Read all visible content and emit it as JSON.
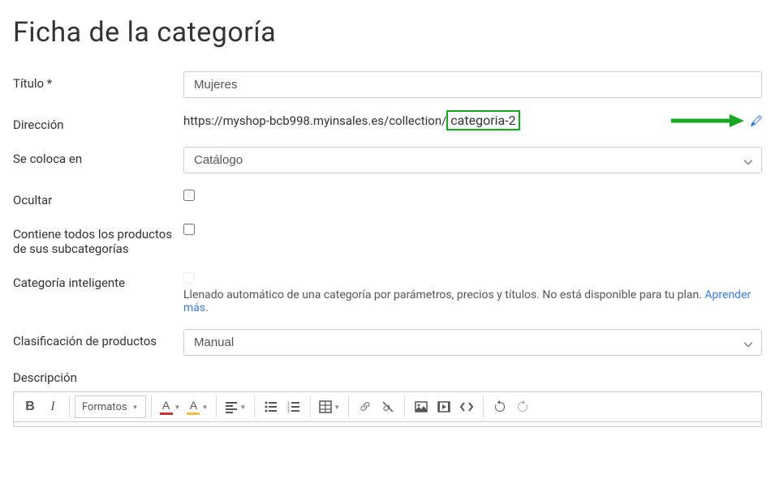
{
  "page": {
    "title": "Ficha de la categoría"
  },
  "form": {
    "title_label": "Título *",
    "title_value": "Mujeres",
    "address_label": "Dirección",
    "address_url_prefix": "https://myshop-bcb998.myinsales.es/collection/",
    "address_slug": "categoria-2",
    "placed_in_label": "Se coloca en",
    "placed_in_value": "Catálogo",
    "hide_label": "Ocultar",
    "hide_checked": false,
    "contains_all_label": "Contiene todos los productos de sus subcategorías",
    "contains_all_checked": false,
    "smart_category_label": "Categoría inteligente",
    "smart_category_checked": false,
    "smart_category_help": "Llenado automático de una categoría por parámetros, precios y títulos. No está disponible para tu plan. ",
    "smart_category_link": "Aprender más",
    "classification_label": "Clasificación de productos",
    "classification_value": "Manual",
    "description_label": "Descripción"
  },
  "toolbar": {
    "formats_label": "Formatos",
    "icons": {
      "bold": "bold",
      "italic": "italic",
      "text_color": "text-color",
      "bg_color": "bg-color",
      "align_left": "align-left",
      "list_bullet": "list-bullet",
      "list_number": "list-number",
      "table": "table",
      "link": "link",
      "unlink": "unlink",
      "image": "image",
      "media": "media",
      "code": "code",
      "undo": "undo",
      "redo": "redo"
    }
  },
  "colors": {
    "highlight_green": "#17a823",
    "link_blue": "#3b7dd8"
  }
}
